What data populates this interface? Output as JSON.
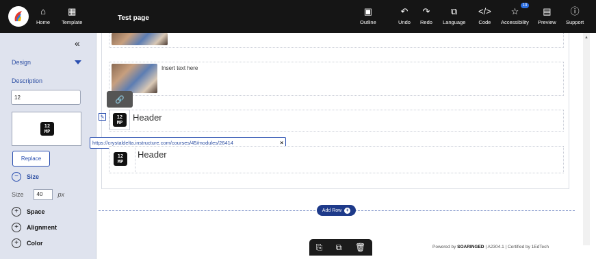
{
  "topbar": {
    "title": "Test page",
    "buttons": [
      {
        "label": "Home",
        "icon": "home-icon"
      },
      {
        "label": "Template",
        "icon": "template-icon"
      },
      {
        "label": "Outline",
        "icon": "outline-icon"
      },
      {
        "label": "Undo",
        "icon": "undo-icon"
      },
      {
        "label": "Redo",
        "icon": "redo-icon"
      },
      {
        "label": "Language",
        "icon": "language-icon"
      },
      {
        "label": "Code",
        "icon": "code-icon"
      },
      {
        "label": "Accessibility",
        "icon": "accessibility-icon",
        "badge": "13"
      },
      {
        "label": "Preview",
        "icon": "preview-icon"
      },
      {
        "label": "Support",
        "icon": "support-icon"
      }
    ]
  },
  "sidebar": {
    "collapse_glyph": "«",
    "design_label": "Design",
    "description_label": "Description",
    "description_value": "12",
    "replace_label": "Replace",
    "size_label": "Size",
    "size_field_label": "Size",
    "size_value": "40",
    "size_unit": "px",
    "sections": [
      "Space",
      "Alignment",
      "Color"
    ]
  },
  "canvas": {
    "insert_text": "Insert text here",
    "header_1": "Header",
    "header_2": "Header",
    "link_url": "https://crystaldelta.instructure.com/courses/45/modules/26414",
    "link_close": "×",
    "add_row_label": "Add Row"
  },
  "footer": {
    "powered_by": "Powered by",
    "brand": "SOARINGED",
    "version": "| A2304.1 | Certified by",
    "certifier": "1EdTech"
  },
  "colors": {
    "topbar_bg": "#151515",
    "sidebar_bg": "#dfe3ee",
    "accent": "#2a4fb0",
    "add_row_bg": "#1e3a8a"
  }
}
